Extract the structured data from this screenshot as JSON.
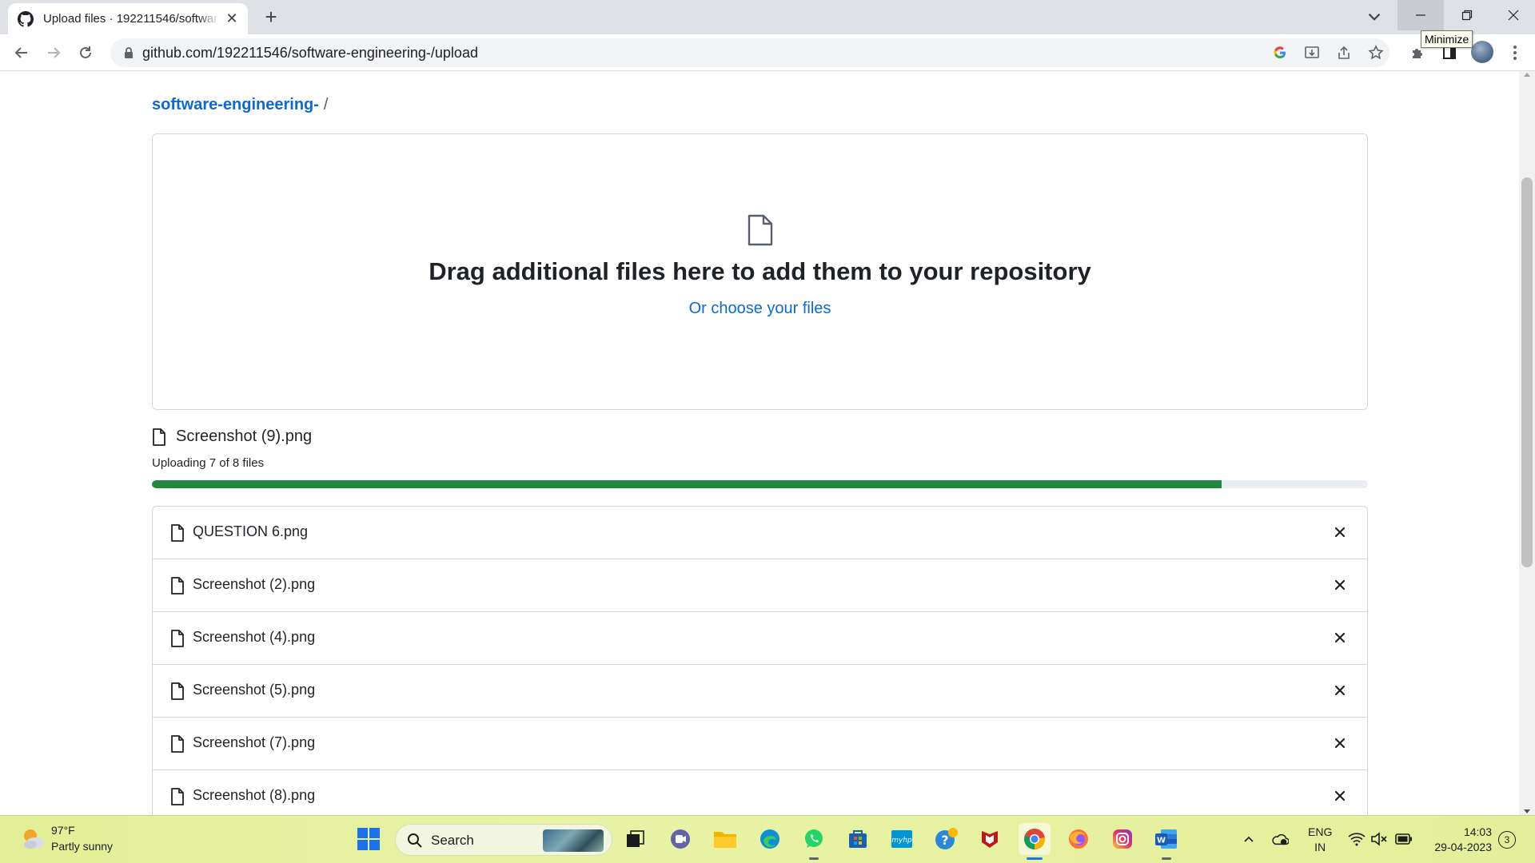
{
  "browser": {
    "tab": {
      "title": "Upload files · 192211546/software-engineering-",
      "favicon": "github-icon"
    },
    "url": "github.com/192211546/software-engineering-/upload",
    "tooltip": "Minimize"
  },
  "page": {
    "breadcrumb": {
      "repo": "software-engineering-",
      "separator": "/"
    },
    "dropzone": {
      "title": "Drag additional files here to add them to your repository",
      "prefix": "Or",
      "link": "choose your files"
    },
    "upload": {
      "current_file": "Screenshot (9).png",
      "status": "Uploading 7 of 8 files",
      "progress_fraction": 0.88
    },
    "files": [
      {
        "name": "QUESTION 6.png"
      },
      {
        "name": "Screenshot (2).png"
      },
      {
        "name": "Screenshot (4).png"
      },
      {
        "name": "Screenshot (5).png"
      },
      {
        "name": "Screenshot (7).png"
      },
      {
        "name": "Screenshot (8).png"
      }
    ]
  },
  "taskbar": {
    "weather": {
      "temp": "97°F",
      "desc": "Partly sunny"
    },
    "search_label": "Search",
    "language": {
      "line1": "ENG",
      "line2": "IN"
    },
    "time": "14:03",
    "date": "29-04-2023",
    "notifications": "3"
  },
  "colors": {
    "accent": "#0969da",
    "progress": "#1f883d",
    "taskbar": "#e3ef96"
  }
}
